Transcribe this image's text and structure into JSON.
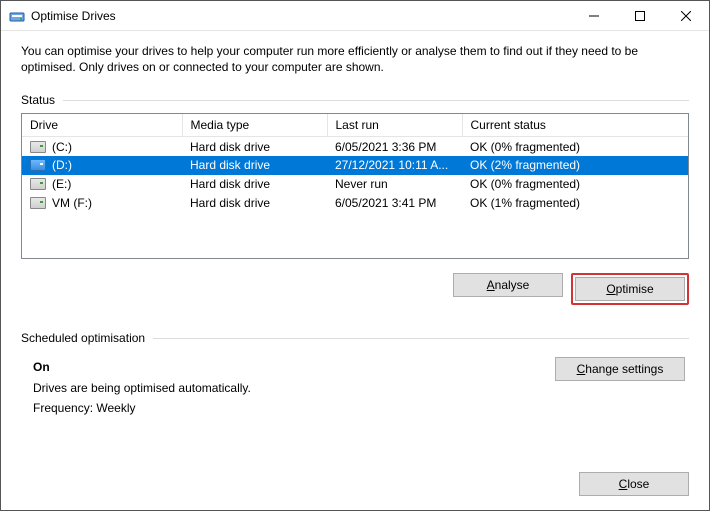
{
  "window": {
    "title": "Optimise Drives"
  },
  "intro": "You can optimise your drives to help your computer run more efficiently or analyse them to find out if they need to be optimised. Only drives on or connected to your computer are shown.",
  "status": {
    "heading": "Status",
    "columns": {
      "drive": "Drive",
      "media": "Media type",
      "lastrun": "Last run",
      "status": "Current status"
    },
    "rows": [
      {
        "drive": "(C:)",
        "media": "Hard disk drive",
        "lastrun": "6/05/2021 3:36 PM",
        "status": "OK (0% fragmented)",
        "selected": false
      },
      {
        "drive": "(D:)",
        "media": "Hard disk drive",
        "lastrun": "27/12/2021 10:11 A...",
        "status": "OK (2% fragmented)",
        "selected": true
      },
      {
        "drive": "(E:)",
        "media": "Hard disk drive",
        "lastrun": "Never run",
        "status": "OK (0% fragmented)",
        "selected": false
      },
      {
        "drive": "VM (F:)",
        "media": "Hard disk drive",
        "lastrun": "6/05/2021 3:41 PM",
        "status": "OK (1% fragmented)",
        "selected": false
      }
    ]
  },
  "actions": {
    "analyse": "Analyse",
    "optimise": "Optimise"
  },
  "scheduled": {
    "heading": "Scheduled optimisation",
    "state": "On",
    "desc": "Drives are being optimised automatically.",
    "freq": "Frequency: Weekly",
    "change": "Change settings"
  },
  "footer": {
    "close": "Close"
  }
}
